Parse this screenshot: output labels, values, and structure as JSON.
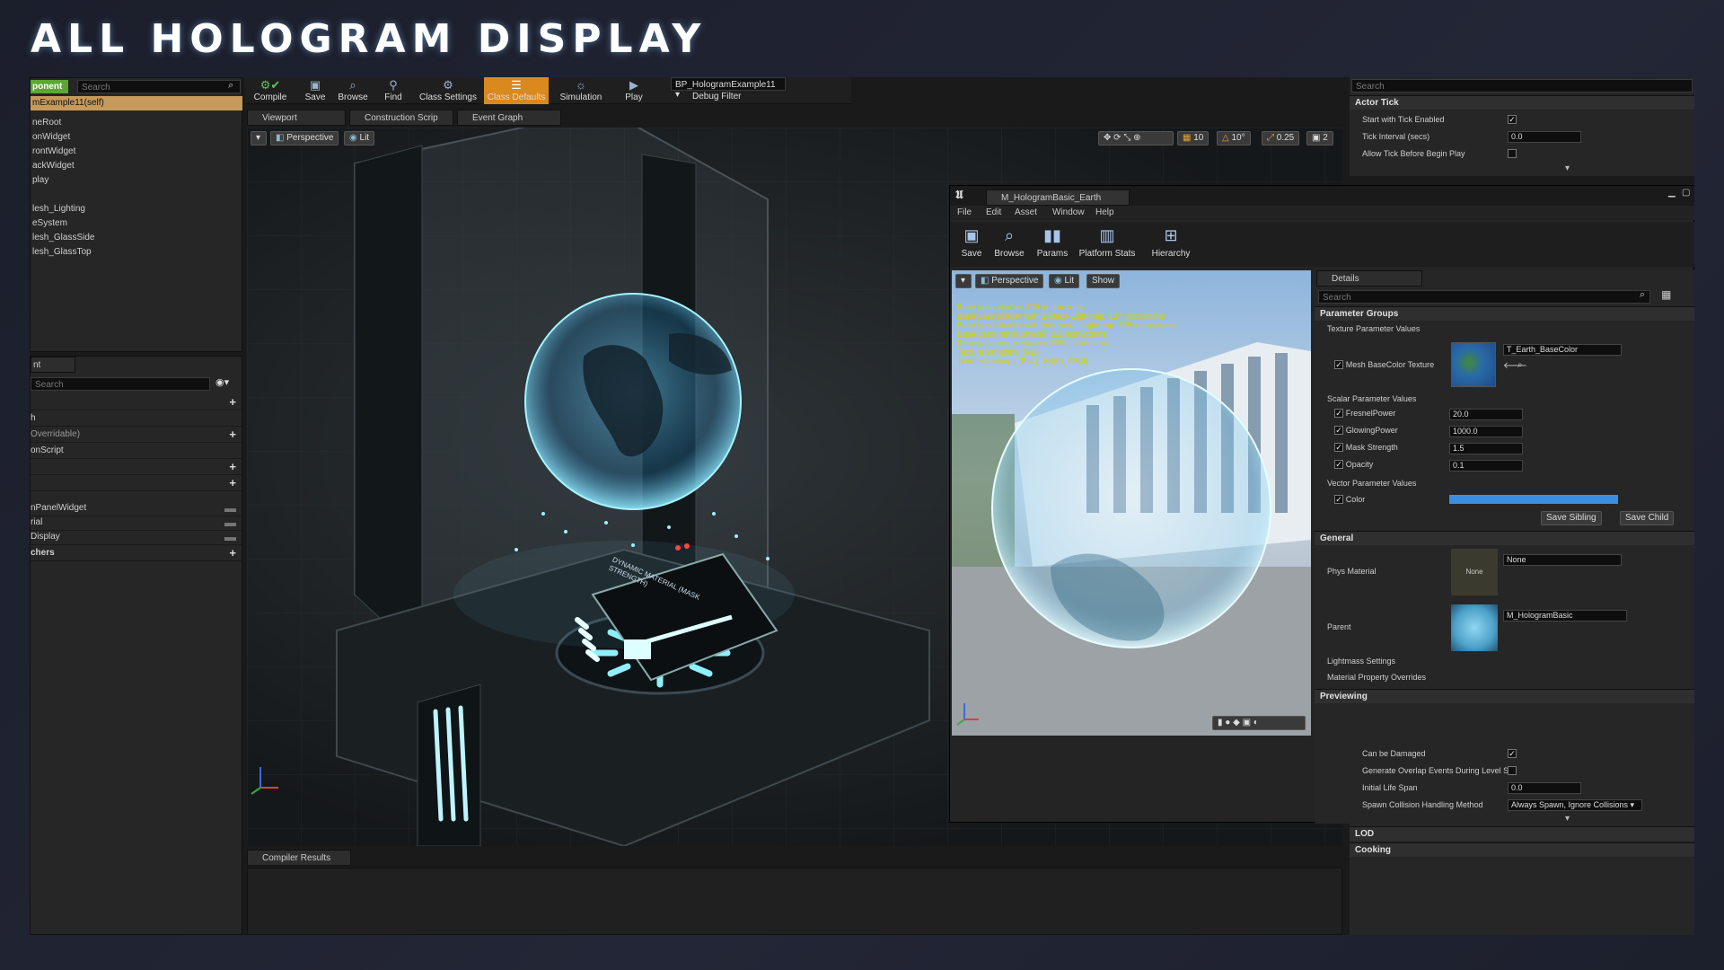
{
  "hero_title": "ALL HOLOGRAM DISPLAY",
  "components": {
    "add_label": "ponent ▾",
    "search_placeholder": "Search",
    "self_item": "mExample11(self)",
    "items": [
      "neRoot",
      "onWidget",
      "rontWidget",
      "ackWidget",
      "play",
      "",
      "lesh_Lighting",
      "eSystem",
      "lesh_GlassSide",
      "lesh_GlassTop"
    ]
  },
  "my_blueprint": {
    "tab_label": "nt",
    "search_placeholder": "Search",
    "rows": [
      "h",
      "Overridable)",
      "onScript",
      "",
      "",
      "nPanelWidget",
      "rial",
      "Display",
      "chers"
    ]
  },
  "toolbar": {
    "buttons": [
      "Compile",
      "Save",
      "Browse",
      "Find",
      "Class Settings",
      "Class Defaults",
      "Simulation",
      "Play"
    ],
    "debug_object": "BP_HologramExample11 ▾",
    "debug_filter": "Debug Filter"
  },
  "editor_tabs": [
    "Viewport",
    "Construction Scrip",
    "Event Graph"
  ],
  "viewport": {
    "perspective": "Perspective",
    "lit": "Lit",
    "grid_snap": "10",
    "rot_snap": "10°",
    "scale_snap": "0.25",
    "cam_speed": "2",
    "screen_text": "DYNAMIC MATERIAL (MASK STRENGTH)"
  },
  "compiler": {
    "tab": "Compiler Results"
  },
  "material_editor": {
    "window_title": "M_HologramBasic_Earth",
    "menu": [
      "File",
      "Edit",
      "Asset",
      "Window",
      "Help"
    ],
    "tools": [
      "Save",
      "Browse",
      "Params",
      "Platform Stats",
      "Hierarchy"
    ],
    "perspective": "Perspective",
    "lit": "Lit",
    "show": "Show",
    "stats": [
      "Base pass shader: 109 instructions",
      "Base pass shader with Surface Lightmap: 137 instructions",
      "Base pass shader with Volumetric Lightmap: 125 instructions",
      "Base pass vertex shader: 111 instructions",
      "Base pass vertex shader: 163 instructions",
      "Texture samplers: 5/16",
      "Texture Lookups (Est.): VS(0), PS(4)"
    ]
  },
  "details": {
    "tab": "Details",
    "search_placeholder": "Search",
    "parameter_groups": "Parameter Groups",
    "texture_params": "Texture Parameter Values",
    "mesh_basecolor": "Mesh BaseColor Texture",
    "texture_value": "T_Earth_BaseColor",
    "scalar_params": "Scalar Parameter Values",
    "scalars": [
      {
        "name": "FresnelPower",
        "value": "20.0"
      },
      {
        "name": "GlowingPower",
        "value": "1000.0"
      },
      {
        "name": "Mask Strength",
        "value": "1.5"
      },
      {
        "name": "Opacity",
        "value": "0.1"
      }
    ],
    "vector_params": "Vector Parameter Values",
    "color_label": "Color",
    "color_value": "#3a8fe0",
    "save_sibling": "Save Sibling",
    "save_child": "Save Child",
    "general": "General",
    "phys_material": "Phys Material",
    "phys_value": "None",
    "phys_thumb": "None",
    "parent": "Parent",
    "parent_value": "M_HologramBasic",
    "lightmass": "Lightmass Settings",
    "overrides": "Material Property Overrides",
    "previewing": "Previewing"
  },
  "class_defaults": {
    "search_placeholder": "Search",
    "actor_tick": "Actor Tick",
    "start_tick": "Start with Tick Enabled",
    "tick_interval": "Tick Interval (secs)",
    "tick_interval_value": "0.0",
    "allow_tick": "Allow Tick Before Begin Play",
    "can_be_damaged": "Can be Damaged",
    "overlap": "Generate Overlap Events During Level S",
    "life_span": "Initial Life Span",
    "life_span_value": "0.0",
    "spawn_collision": "Spawn Collision Handling Method",
    "spawn_value": "Always Spawn, Ignore Collisions ▾",
    "lod": "LOD",
    "cooking": "Cooking"
  }
}
